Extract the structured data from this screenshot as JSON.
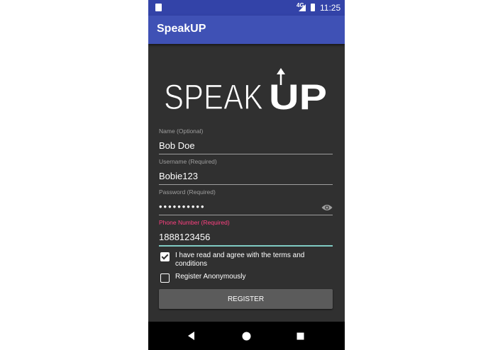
{
  "status_bar": {
    "network": "4G",
    "time": "11:25"
  },
  "app_bar": {
    "title": "SpeakUP"
  },
  "logo": {
    "text_light": "SPEAK",
    "text_bold": "UP"
  },
  "form": {
    "name": {
      "label": "Name (Optional)",
      "value": "Bob Doe"
    },
    "username": {
      "label": "Username (Required)",
      "value": "Bobie123"
    },
    "password": {
      "label": "Password (Required)",
      "value": "••••••••••"
    },
    "phone": {
      "label": "Phone Number (Required)",
      "value": "1888123456"
    },
    "terms": {
      "label": "I have read and agree with the terms and conditions",
      "checked": true
    },
    "anonymous": {
      "label": "Register Anonymously",
      "checked": false
    },
    "register_label": "REGISTER"
  },
  "colors": {
    "status_bar": "#3343a8",
    "app_bar": "#3f51b5",
    "background": "#303030",
    "focus_label": "#ff4081",
    "focus_underline": "#80cbc4"
  },
  "icons": [
    "sim-icon",
    "signal-icon",
    "battery-icon",
    "eye-icon",
    "back-icon",
    "home-icon",
    "recents-icon"
  ]
}
